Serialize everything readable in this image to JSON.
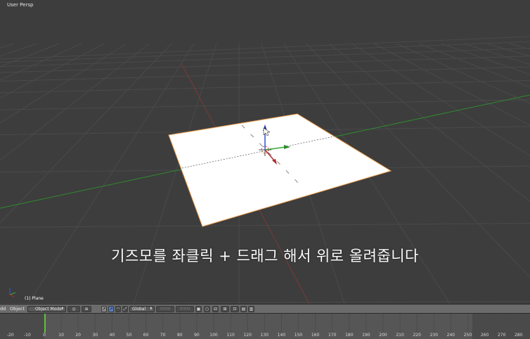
{
  "viewport": {
    "label": "User Persp",
    "object_label": "(1) Plane",
    "subtitle": "기즈모를 좌클릭 + 드래그 해서 위로 올려줍니다"
  },
  "toolbar": {
    "menu_add": "dd",
    "menu_object": "Object",
    "mode_label": "Object Mode",
    "orientation_label": "Global"
  },
  "timeline": {
    "ticks": [
      "-20",
      "-10",
      "0",
      "10",
      "20",
      "30",
      "40",
      "50",
      "60",
      "70",
      "80",
      "90",
      "100",
      "110",
      "120",
      "130",
      "140",
      "150",
      "160",
      "170",
      "180",
      "190",
      "200",
      "210",
      "220",
      "230",
      "240",
      "250",
      "260",
      "270",
      "280"
    ],
    "current_frame": 1
  },
  "colors": {
    "viewport_bg": "#3d3d3d",
    "x_axis": "#b02a2a",
    "y_axis": "#3aa83a",
    "z_axis": "#3050d0",
    "plane": "#ffffff",
    "plane_outline": "#f0a050"
  }
}
